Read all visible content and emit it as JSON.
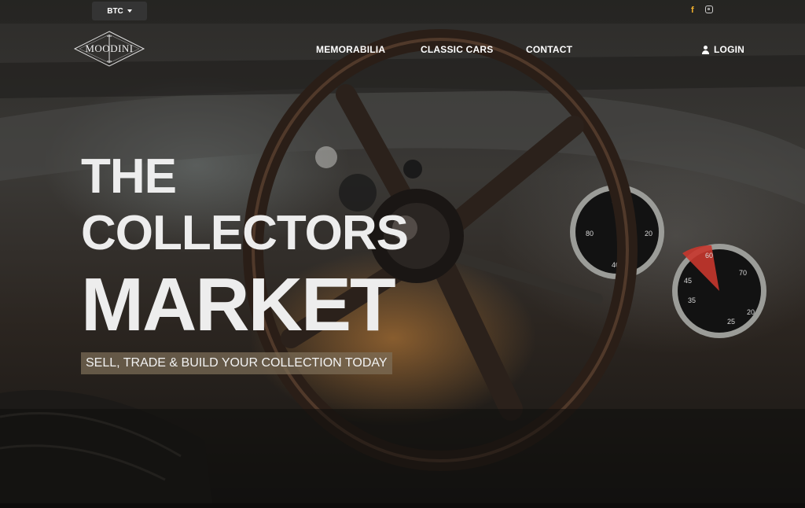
{
  "topbar": {
    "currency": "BTC",
    "social": {
      "facebook": "f",
      "instagram_icon": "instagram-icon"
    }
  },
  "brand": {
    "logo_text": "MOODINI"
  },
  "nav": {
    "items": [
      {
        "label": "MEMORABILIA"
      },
      {
        "label": "CLASSIC CARS"
      },
      {
        "label": "CONTACT"
      }
    ],
    "login": "LOGIN"
  },
  "hero": {
    "line1": "THE",
    "line2": "COLLECTORS",
    "line3": "MARKET",
    "subtitle": "SELL, TRADE & BUILD YOUR COLLECTION TODAY"
  }
}
